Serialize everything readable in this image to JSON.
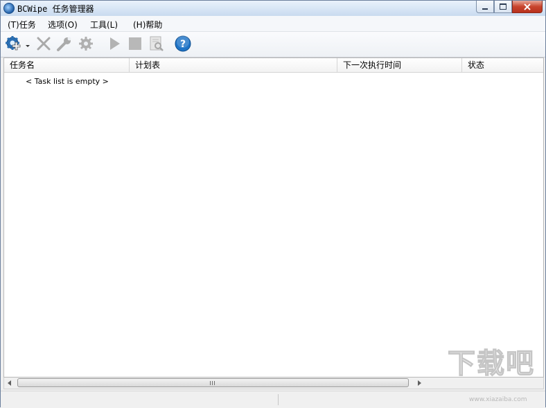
{
  "window": {
    "title": "BCWipe 任务管理器"
  },
  "menu": [
    {
      "label": "(T)任务"
    },
    {
      "label": "选项(O)"
    },
    {
      "label": "工具(L)"
    },
    {
      "label": "(H)帮助"
    }
  ],
  "toolbar": {
    "icons": [
      "new-task-icon",
      "dropdown-arrow-icon",
      "delete-icon",
      "wrench-icon",
      "settings-gear-icon",
      "play-icon",
      "stop-icon",
      "view-log-icon",
      "help-icon"
    ]
  },
  "table": {
    "columns": [
      "任务名",
      "计划表",
      "下一次执行时间",
      "状态"
    ],
    "empty_text": "< Task list is empty >"
  },
  "watermark": {
    "text": "下载吧",
    "url": "www.xiazaiba.com"
  },
  "colors": {
    "help_blue": "#1e73c6",
    "close_red": "#c8442d"
  }
}
